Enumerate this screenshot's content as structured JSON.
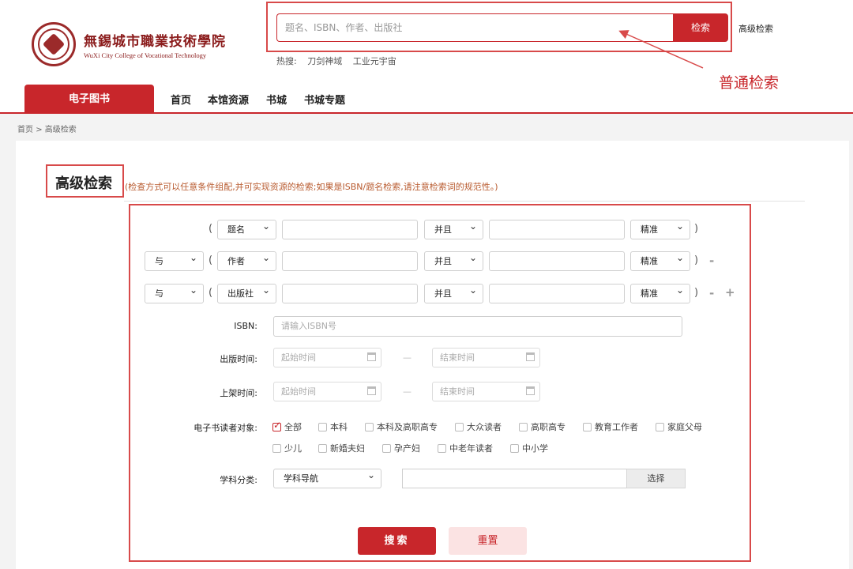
{
  "logo": {
    "name_cn": "無錫城市職業技術學院",
    "name_en": "WuXi City College of Vocational Technology"
  },
  "search": {
    "placeholder": "题名、ISBN、作者、出版社",
    "button": "检索",
    "advanced_link": "高级检索",
    "hot_label": "热搜:",
    "hot_terms": [
      "刀剑神域",
      "工业元宇宙"
    ]
  },
  "annotations": {
    "basic_search": "普通检索"
  },
  "nav": {
    "ebook": "电子图书",
    "items": [
      "首页",
      "本馆资源",
      "书城",
      "书城专题"
    ]
  },
  "breadcrumb": {
    "home": "首页",
    "sep": ">",
    "current": "高级检索"
  },
  "advanced": {
    "title": "高级检索",
    "note": "(检查方式可以任意条件组配,并可实现资源的检索;如果是ISBN/题名检索,请注意检索词的规范性。)",
    "rows": [
      {
        "bool": "",
        "field": "题名",
        "op": "并且",
        "match": "精准"
      },
      {
        "bool": "与",
        "field": "作者",
        "op": "并且",
        "match": "精准"
      },
      {
        "bool": "与",
        "field": "出版社",
        "op": "并且",
        "match": "精准"
      }
    ],
    "open_paren": "(",
    "close_paren": ")",
    "minus": "-",
    "plus": "+",
    "isbn_label": "ISBN:",
    "isbn_placeholder": "请输入ISBN号",
    "pub_time_label": "出版时间:",
    "shelf_time_label": "上架时间:",
    "start_placeholder": "起始时间",
    "end_placeholder": "结束时间",
    "range_dash": "—",
    "audience_label": "电子书读者对象:",
    "audience": [
      "全部",
      "本科",
      "本科及高职高专",
      "大众读者",
      "高职高专",
      "教育工作者",
      "家庭父母",
      "少儿",
      "新婚夫妇",
      "孕产妇",
      "中老年读者",
      "中小学"
    ],
    "audience_checked": "全部",
    "subject_label": "学科分类:",
    "subject_select": "学科导航",
    "subject_button": "选择",
    "search_button": "搜索",
    "reset_button": "重置"
  },
  "colors": {
    "accent": "#c8262b",
    "annotation": "#d84a4a"
  }
}
